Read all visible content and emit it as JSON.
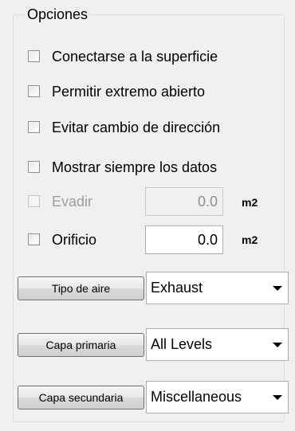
{
  "group": {
    "title": "Opciones"
  },
  "checkboxes": [
    {
      "label": "Conectarse a la superficie",
      "checked": false,
      "enabled": true
    },
    {
      "label": "Permitir extremo abierto",
      "checked": false,
      "enabled": true
    },
    {
      "label": "Evitar cambio de dirección",
      "checked": false,
      "enabled": true
    },
    {
      "label": "Mostrar siempre los datos",
      "checked": false,
      "enabled": true
    },
    {
      "label": "Evadir",
      "checked": false,
      "enabled": false,
      "value": "0.0",
      "unit": "m2"
    },
    {
      "label": "Orificio",
      "checked": false,
      "enabled": true,
      "value": "0.0",
      "unit": "m2"
    }
  ],
  "selectors": [
    {
      "button_label": "Tipo de aire",
      "selected": "Exhaust"
    },
    {
      "button_label": "Capa primaria",
      "selected": "All Levels"
    },
    {
      "button_label": "Capa secundaria",
      "selected": "Miscellaneous"
    }
  ]
}
